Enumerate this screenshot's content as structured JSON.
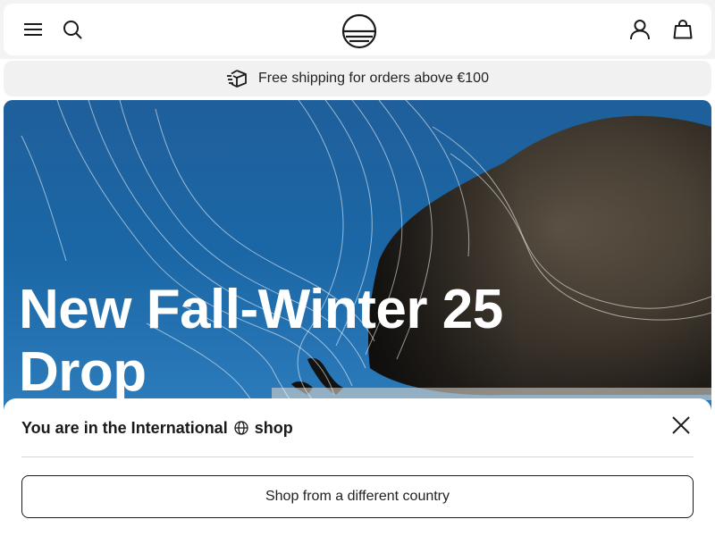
{
  "header": {
    "menu_icon": "hamburger-menu-icon",
    "search_icon": "search-icon",
    "logo_icon": "brand-logo-icon",
    "account_icon": "user-account-icon",
    "cart_icon": "shopping-bag-icon"
  },
  "promo": {
    "icon": "shipping-box-icon",
    "text": "Free shipping for orders above €100"
  },
  "hero": {
    "title_line1": "New Fall-Winter 25",
    "title_line2": "Drop"
  },
  "country_sheet": {
    "text_before": "You are in the International",
    "globe_icon": "globe-icon",
    "text_after": "shop",
    "close_icon": "close-icon",
    "button_label": "Shop from a different country"
  },
  "colors": {
    "sky": "#1b67a6",
    "text": "#1a1a1a",
    "white": "#ffffff"
  }
}
